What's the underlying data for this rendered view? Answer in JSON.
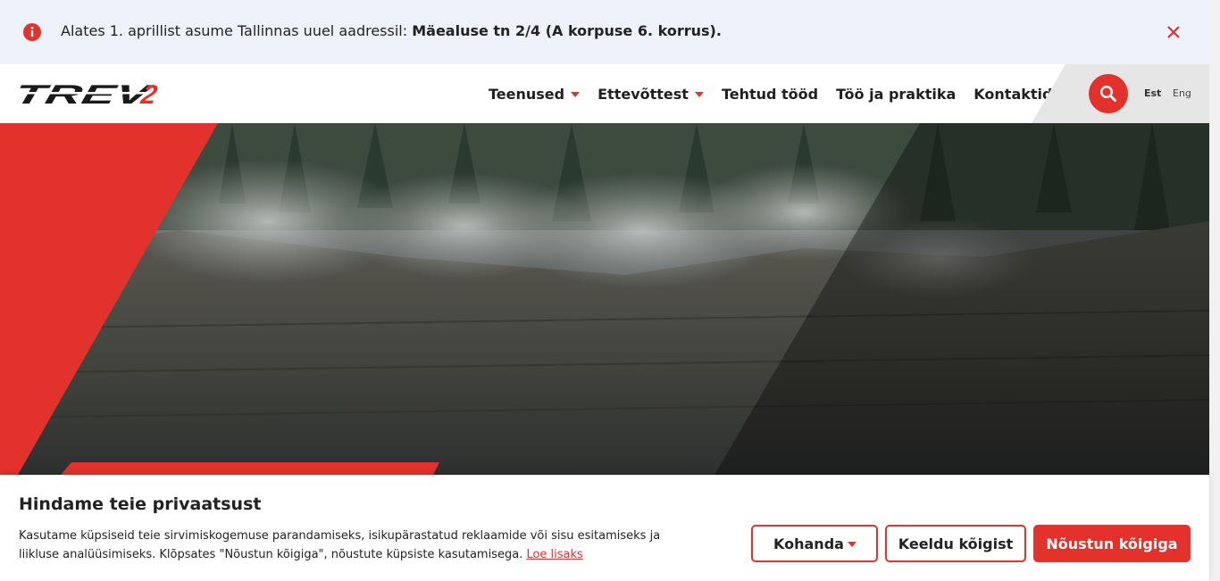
{
  "announcement": {
    "text": "Alates 1. aprillist asume Tallinnas uuel aadressil:",
    "bold_text": "Mäealuse tn 2/4 (A korpuse 6. korrus).",
    "info_icon": "info-icon",
    "close_icon": "close-icon"
  },
  "header": {
    "logo": "TREV2",
    "nav": [
      {
        "label": "Teenused",
        "has_dropdown": true
      },
      {
        "label": "Ettevõttest",
        "has_dropdown": true
      },
      {
        "label": "Tehtud tööd",
        "has_dropdown": false
      },
      {
        "label": "Töö ja praktika",
        "has_dropdown": false
      },
      {
        "label": "Kontaktid",
        "has_dropdown": false
      }
    ],
    "search_icon": "search-icon",
    "languages": {
      "est": "Est",
      "eng": "Eng"
    }
  },
  "cookie": {
    "title": "Hindame teie privaatsust",
    "text": "Kasutame küpsiseid teie sirvimiskogemuse parandamiseks, isikupärastatud reklaamide või sisu esitamiseks ja liikluse analüüsimiseks. Klõpsates \"Nõustun kõigiga\", nõustute küpsiste kasutamisega.",
    "link": "Loe lisaks",
    "buttons": {
      "customize": "Kohanda",
      "reject": "Keeldu kõigist",
      "accept": "Nõustun kõigiga"
    }
  },
  "colors": {
    "brand_red": "#e3312b",
    "announcement_bg": "#eef3fb"
  }
}
